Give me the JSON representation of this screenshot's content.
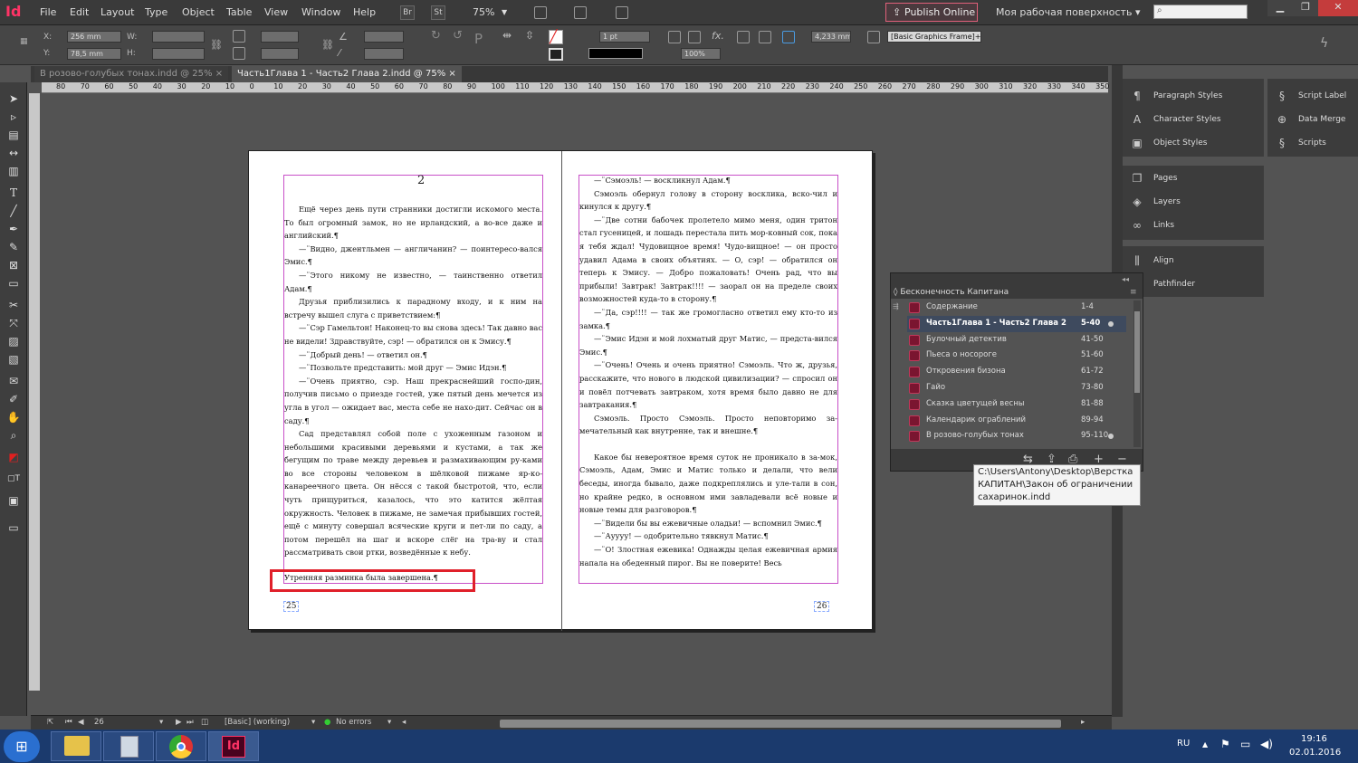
{
  "menubar": {
    "logo": "Id",
    "items": [
      "File",
      "Edit",
      "Layout",
      "Type",
      "Object",
      "Table",
      "View",
      "Window",
      "Help"
    ],
    "bridge": "Br",
    "stock": "St",
    "zoom": "75%",
    "publish": "Publish Online",
    "workspace": "Моя рабочая поверхность"
  },
  "controlbar": {
    "x_label": "X:",
    "x_value": "256 mm",
    "y_label": "Y:",
    "y_value": "78,5 mm",
    "w_label": "W:",
    "h_label": "H:",
    "stroke_weight": "1 pt",
    "width_value": "4,233 mm",
    "scale_value": "100%",
    "frame_style": "[Basic Graphics Frame]+"
  },
  "tabs": [
    {
      "label": "В розово-голубых тонах.indd @ 25%"
    },
    {
      "label": "Часть1Глава 1 - Часть2 Глава 2.indd @ 75%"
    }
  ],
  "ruler_ticks": [
    "80",
    "70",
    "60",
    "50",
    "40",
    "30",
    "20",
    "10",
    "0",
    "10",
    "20",
    "30",
    "40",
    "50",
    "60",
    "70",
    "80",
    "90",
    "100",
    "110",
    "120",
    "130",
    "140",
    "150",
    "160",
    "170",
    "180",
    "190",
    "200",
    "210",
    "220",
    "230",
    "240",
    "250",
    "260",
    "270",
    "280",
    "290",
    "300",
    "310",
    "320",
    "330",
    "340",
    "350"
  ],
  "page_left": {
    "running_number": "2",
    "paragraphs": [
      "Ещё через день пути странники достигли искомого места. То был огромный замок, но не ирландский, а во-все даже и английский.¶",
      "—¨Видно, джентльмен — англичанин? — поинтересо-вался Эмис.¶",
      "—¨Этого никому не известно, — таинственно ответил Адам.¶",
      "Друзья приблизились к парадному входу, и к ним на встречу вышел слуга с приветствием:¶",
      "—¨Сэр Гамельтон! Наконец-то вы снова здесь! Так давно вас не видели! Здравствуйте, сэр! — обратился он к Эмису.¶",
      "—¨Добрый день! — ответил он.¶",
      "—¨Позвольте представить: мой друг — Эмис Идэн.¶",
      "—¨Очень приятно, сэр. Наш прекраснейший госпо-дин, получив письмо о приезде гостей, уже пятый день мечется из угла в угол — ожидает вас, места себе не нахо-дит. Сейчас он в саду.¶",
      "Сад представлял собой поле с ухоженным газоном и небольшими красивыми деревьями и кустами, а так же бегущим по траве между деревьев и размахивающим ру-ками во все стороны человеком в шёлковой пижаме яр-ко-канареечного цвета. Он нёсся с такой быстротой, что, если чуть прищуриться, казалось, что это катится жёлтая окружность. Человек в пижаме, не замечая прибывших гостей, ещё с минуту совершал всяческие круги и пет-ли по саду, а потом перешёл на шаг и вскоре слёг на тра-ву и стал рассматривать свои ртки, возведённые к небу.",
      "Утренняя разминка была завершена.¶"
    ],
    "page_number": "25"
  },
  "page_right": {
    "paragraphs": [
      "—¨Сэмоэль! — воскликнул Адам.¶",
      "Сэмоэль обернул голову в сторону восклика, вско-чил и кинулся к другу.¶",
      "—¨Две сотни бабочек пролетело мимо меня, один тритон стал гусеницей, и лошадь перестала пить мор-ковный сок, пока я тебя ждал! Чудовищное время! Чудо-вищное! — он просто удавил Адама в своих объятиях. — О, сэр! — обратился он теперь к Эмису. — Добро пожаловать! Очень рад, что вы прибыли! Завтрак! Завтрак!!!! — заорал он на пределе своих возможностей куда-то в сторону.¶",
      "—¨Да, сэр!!!! — так же громогласно ответил ему кто-то из замка.¶",
      "—¨Эмис Идэн и мой лохматый друг Матис, — предста-вился Эмис.¶",
      "—¨Очень! Очень и очень приятно! Сэмоэль. Что ж, друзья, расскажите, что нового в людской цивилизации? — спросил он и повёл потчевать завтраком, хотя время было давно не для завтракания.¶",
      "Сэмоэль. Просто Сэмоэль. Просто неповторимо за-мечательный как внутренне, так и внешне.¶",
      "",
      "Какое бы невероятное время суток не проникало в за-мок, Сэмоэль, Адам, Эмис и Матис только и делали, что вели беседы, иногда бывало, даже подкреплялись и уле-тали в сон, но крайне редко, в основном ими завладевали всё новые и новые темы для разговоров.¶",
      "—¨Видели бы вы ежевичные оладьи! — вспомнил Эмис.¶",
      "—¨Ауууу! — одобрительно тявкнул Матис.¶",
      "—¨О! Злостная ежевика! Однажды целая ежевичная армия напала на обеденный пирог. Вы не поверите! Весь"
    ],
    "page_number": "26"
  },
  "panels": {
    "group1": [
      "Paragraph Styles",
      "Character Styles",
      "Object Styles"
    ],
    "group2": [
      "Script Label",
      "Data Merge",
      "Scripts"
    ],
    "group3": [
      "Pages",
      "Layers",
      "Links"
    ],
    "group4": [
      "Align",
      "Pathfinder"
    ]
  },
  "book_panel": {
    "title": "Бесконечность Капитана",
    "rows": [
      {
        "name": "Содержание",
        "pages": "1-4"
      },
      {
        "name": "Часть1Глава 1 - Часть2 Глава 2",
        "pages": "5-40"
      },
      {
        "name": "Булочный детектив",
        "pages": "41-50"
      },
      {
        "name": "Пьеса о носороге",
        "pages": "51-60"
      },
      {
        "name": "Откровения бизона",
        "pages": "61-72"
      },
      {
        "name": "Гайо",
        "pages": "73-80"
      },
      {
        "name": "Сказка цветущей весны",
        "pages": "81-88"
      },
      {
        "name": "Календарик ограблений",
        "pages": "89-94"
      },
      {
        "name": "В розово-голубых тонах",
        "pages": "95-110"
      }
    ],
    "tooltip": "C:\\Users\\Antony\\Desktop\\Верстка КАПИТАН\\Закон об ограничении сахаринок.indd"
  },
  "statusbar": {
    "page": "26",
    "profile": "[Basic] (working)",
    "errors": "No errors"
  },
  "taskbar": {
    "lang": "RU",
    "time": "19:16",
    "date": "02.01.2016",
    "app_label": "Id"
  },
  "colors": {
    "accent": "#ff3366",
    "frame": "#c84fc8",
    "highlight": "#e0202a"
  }
}
